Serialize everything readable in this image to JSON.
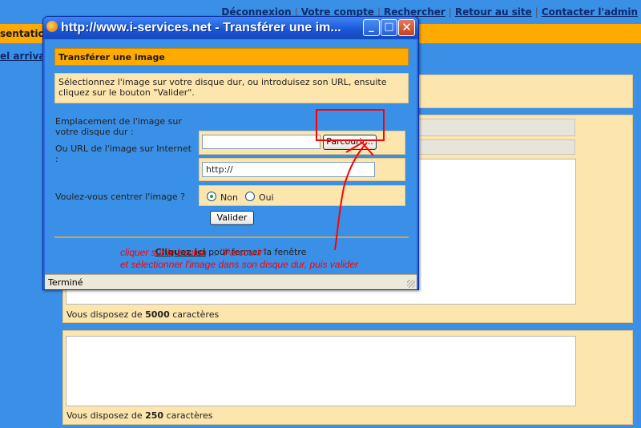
{
  "topnav": {
    "disconnect": "Déconnexion",
    "account": "Votre compte",
    "search": "Rechercher",
    "back_to_site": "Retour au site",
    "contact_admin": "Contacter l'admin",
    "separator": "|"
  },
  "page": {
    "section_title": "sentation",
    "arrivals_link": "el arrivan",
    "counter1": {
      "prefix": "Vous disposez de ",
      "value": "5000",
      "suffix": " caractères"
    },
    "counter2": {
      "prefix": "Vous disposez de ",
      "value": "250",
      "suffix": " caractères"
    }
  },
  "window": {
    "title": "http://www.i-services.net - Transférer une im...",
    "minimize_label": "_",
    "maximize_label": "□",
    "close_label": "✕",
    "header": "Transférer une image",
    "instructions": "Sélectionnez l'image sur votre disque dur, ou introduisez son URL, ensuite cliquez sur le bouton \"Valider\".",
    "file_label": "Emplacement de l'image sur votre disque dur :",
    "file_value": "",
    "browse_button": "Parcourir...",
    "url_label": "Ou URL de l'image sur Internet :",
    "url_value": "http://",
    "center_label": "Voulez-vous centrer l'image ?",
    "center_options": [
      {
        "label": "Non",
        "checked": true
      },
      {
        "label": "Oui",
        "checked": false
      }
    ],
    "validate_button": "Valider",
    "close_link": "Cliquez ici",
    "close_text": " pour fermer la fenêtre",
    "status": "Terminé"
  },
  "annotation": {
    "line1": "cliquer sur le bouton ... \"Parcourir\"",
    "line2": "et sélectionner l'image dans son disque dur, puis valider",
    "color": "#ff0000"
  }
}
